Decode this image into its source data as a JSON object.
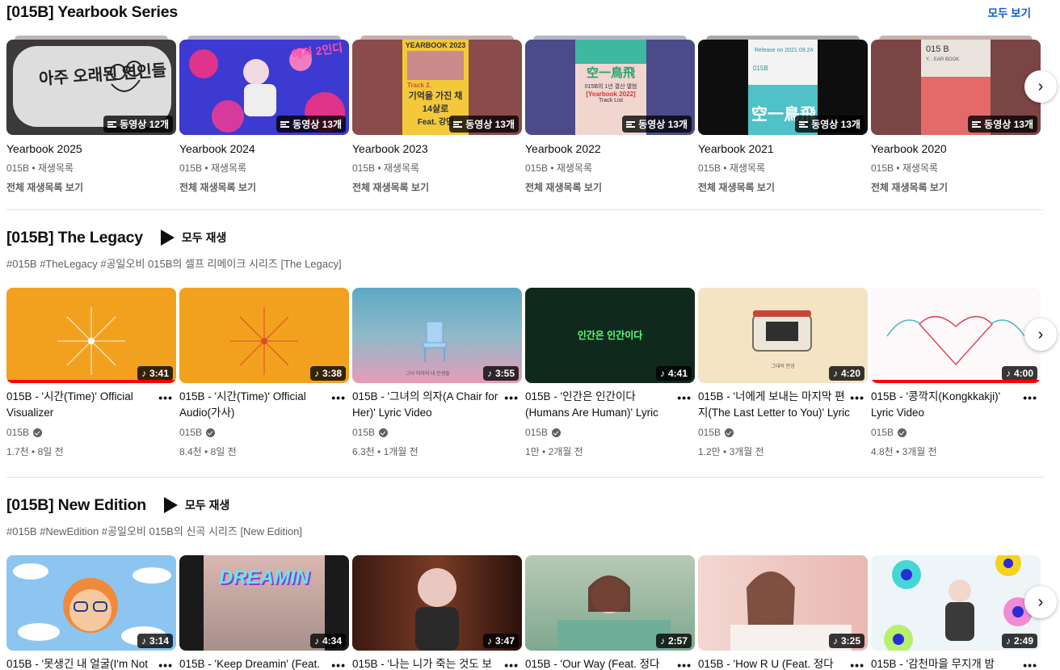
{
  "sections": [
    {
      "title": "[015B] Yearbook Series",
      "see_all": "모두 보기",
      "playlists": [
        {
          "title": "Yearbook 2025",
          "meta": "015B • 재생목록",
          "link": "전체 재생목록 보기",
          "count": "동영상 12개",
          "color": "#3a3a3a"
        },
        {
          "title": "Yearbook 2024",
          "meta": "015B • 재생목록",
          "link": "전체 재생목록 보기",
          "count": "동영상 13개",
          "color": "#4a3aa6"
        },
        {
          "title": "Yearbook 2023",
          "meta": "015B • 재생목록",
          "link": "전체 재생목록 보기",
          "count": "동영상 13개",
          "color": "#7a4a4a"
        },
        {
          "title": "Yearbook 2022",
          "meta": "015B • 재생목록",
          "link": "전체 재생목록 보기",
          "count": "동영상 13개",
          "color": "#4a4a86"
        },
        {
          "title": "Yearbook 2021",
          "meta": "015B • 재생목록",
          "link": "전체 재생목록 보기",
          "count": "동영상 13개",
          "color": "#111111"
        },
        {
          "title": "Yearbook 2020",
          "meta": "015B • 재생목록",
          "link": "전체 재생목록 보기",
          "count": "동영상 13개",
          "color": "#7a4544"
        }
      ],
      "thumb_text": {
        "p1": "아주 오래된 연인들",
        "p2": "해져 2인디",
        "p3_top": "YEARBOOK 2023",
        "p3_badge": "Track 2.",
        "p3_main": "기억을 가진 채",
        "p3_sub": "14살로",
        "p3_feat": "Feat. 강민",
        "p4_main": "空一鳥飛",
        "p4_line": "[Yearbook 2022]",
        "p4_small": "015B의 1년 결산 앨범",
        "p4_tl": "Track List",
        "p5_top": "Release on 2021.09.24",
        "p5_brand": "015B",
        "p5_main": "空一鳥飛",
        "p6_brand": "015 B",
        "p6_sub": "Y... EAR BOOK"
      }
    },
    {
      "title": "[015B] The Legacy",
      "play_all": "모두 재생",
      "description": "#015B #TheLegacy #공일오비 015B의 셀프 리메이크 시리즈 [The Legacy]",
      "videos": [
        {
          "title": "015B - '시간(Time)' Official Visualizer",
          "channel": "015B",
          "stats": "1.7천 • 8일 전",
          "duration": "3:41",
          "progress": 1.0
        },
        {
          "title": "015B - '시간(Time)' Official Audio(가사)",
          "channel": "015B",
          "stats": "8.4천 • 8일 전",
          "duration": "3:38",
          "progress": 0
        },
        {
          "title": "015B - '그녀의 의자(A Chair for Her)' Lyric Video",
          "channel": "015B",
          "stats": "6.3천 • 1개월 전",
          "duration": "3:55",
          "progress": 0
        },
        {
          "title": "015B - '인간은 인간이다 (Humans Are Human)' Lyric Video",
          "channel": "015B",
          "stats": "1만 • 2개월 전",
          "duration": "4:41",
          "progress": 0
        },
        {
          "title": "015B - '너에게 보내는 마지막 편지(The Last Letter to You)' Lyric Video",
          "channel": "015B",
          "stats": "1.2만 • 3개월 전",
          "duration": "4:20",
          "progress": 0
        },
        {
          "title": "015B - '콩깍지(Kongkkakji)' Lyric Video",
          "channel": "015B",
          "stats": "4.8천 • 3개월 전",
          "duration": "4:00",
          "progress": 1.0
        }
      ],
      "thumb_text": {
        "v4": "인간은 인간이다",
        "v5": "그대의 안녕",
        "v3": "그녀 의자의 내 인생들"
      }
    },
    {
      "title": "[015B] New Edition",
      "play_all": "모두 재생",
      "description": "#015B #NewEdition #공일오비 015B의 신곡 시리즈 [New Edition]",
      "videos": [
        {
          "title": "015B - '못생긴 내 얼굴(I'm Not",
          "duration": "3:14"
        },
        {
          "title": "015B - 'Keep Dreamin' (Feat.",
          "duration": "4:34"
        },
        {
          "title": "015B - '나는 니가 죽는 것도 보",
          "duration": "3:47"
        },
        {
          "title": "015B - 'Our Way (Feat. 정다",
          "duration": "2:57"
        },
        {
          "title": "015B - 'How R U (Feat. 정다",
          "duration": "3:25"
        },
        {
          "title": "015B - '감천마을 무지개 밤",
          "duration": "2:49"
        }
      ],
      "thumb_text": {
        "v2": "DREAMIN"
      }
    }
  ],
  "more_label": "•••",
  "next_label": "›"
}
